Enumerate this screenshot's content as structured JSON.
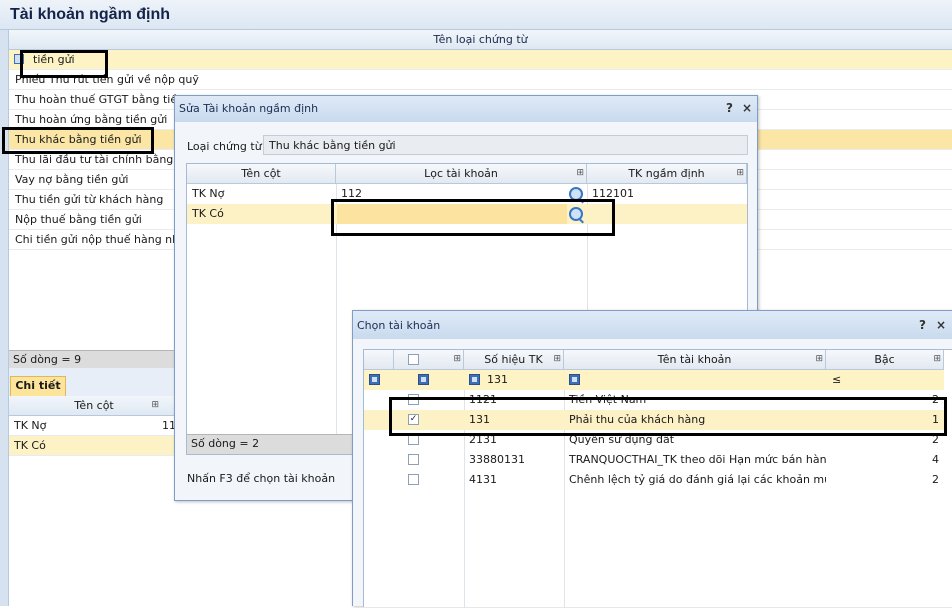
{
  "main": {
    "title": "Tài khoản ngầm định",
    "column_header": "Tên loại chứng từ",
    "rows": [
      "tiền gửi",
      "Phiếu Thu rút tiền gửi về nộp quỹ",
      "Thu hoàn thuế GTGT bằng tiền g",
      "Thu hoàn ứng bằng tiền gửi",
      "Thu khác bằng tiền gửi",
      "Thu lãi đầu tư tài chính bằng tiền",
      "Vay nợ bằng tiền gửi",
      "Thu tiền gửi từ khách hàng",
      "Nộp thuế bằng tiền gửi",
      "Chi tiền gửi nộp thuế hàng nhập k"
    ],
    "footer": "Số dòng = 9",
    "detail_tab": "Chi tiết",
    "detail_header": "Tên cột",
    "detail_rows": [
      {
        "name": "TK Nợ",
        "value": "11"
      },
      {
        "name": "TK Có",
        "value": ""
      }
    ]
  },
  "edit_dialog": {
    "title": "Sửa Tài khoản ngầm định",
    "doc_type_label": "Loại chứng từ",
    "doc_type_value": "Thu khác bằng tiền gửi",
    "columns": [
      "Tên cột",
      "Lọc tài khoản",
      "TK ngầm định"
    ],
    "rows": [
      {
        "col": "TK Nợ",
        "filter": "112",
        "default": "112101"
      },
      {
        "col": "TK Có",
        "filter": "",
        "default": ""
      }
    ],
    "footer": "Số dòng = 2",
    "hint": "Nhấn F3 để chọn tài khoản",
    "help": "?",
    "close": "×"
  },
  "choose_dialog": {
    "title": "Chọn tài khoản",
    "help": "?",
    "close": "×",
    "columns": [
      "Số hiệu TK",
      "Tên tài khoản",
      "Bậc"
    ],
    "filter": {
      "account": "131",
      "level_op": "≤"
    },
    "rows": [
      {
        "checked": false,
        "account": "1121",
        "name": "Tiền Việt Nam",
        "level": "2"
      },
      {
        "checked": true,
        "account": "131",
        "name": "Phải thu của khách hàng",
        "level": "1"
      },
      {
        "checked": false,
        "account": "2131",
        "name": "Quyền sử dụng đất",
        "level": "2"
      },
      {
        "checked": false,
        "account": "33880131",
        "name": "TRANQUOCTHAI_TK theo dõi Hạn mức bán hàng",
        "level": "4"
      },
      {
        "checked": false,
        "account": "4131",
        "name": "Chênh lệch tỷ giá do đánh giá lại các khoản mục...",
        "level": "2"
      }
    ]
  },
  "colors": {
    "highlight": "#fbe6a6",
    "selected": "#fdf3c4",
    "header_blue": "#dfe8f3",
    "title_text": "#15234a"
  },
  "icons": [
    "search-icon",
    "pin-icon",
    "checkbox-icon",
    "help-icon",
    "close-icon"
  ]
}
